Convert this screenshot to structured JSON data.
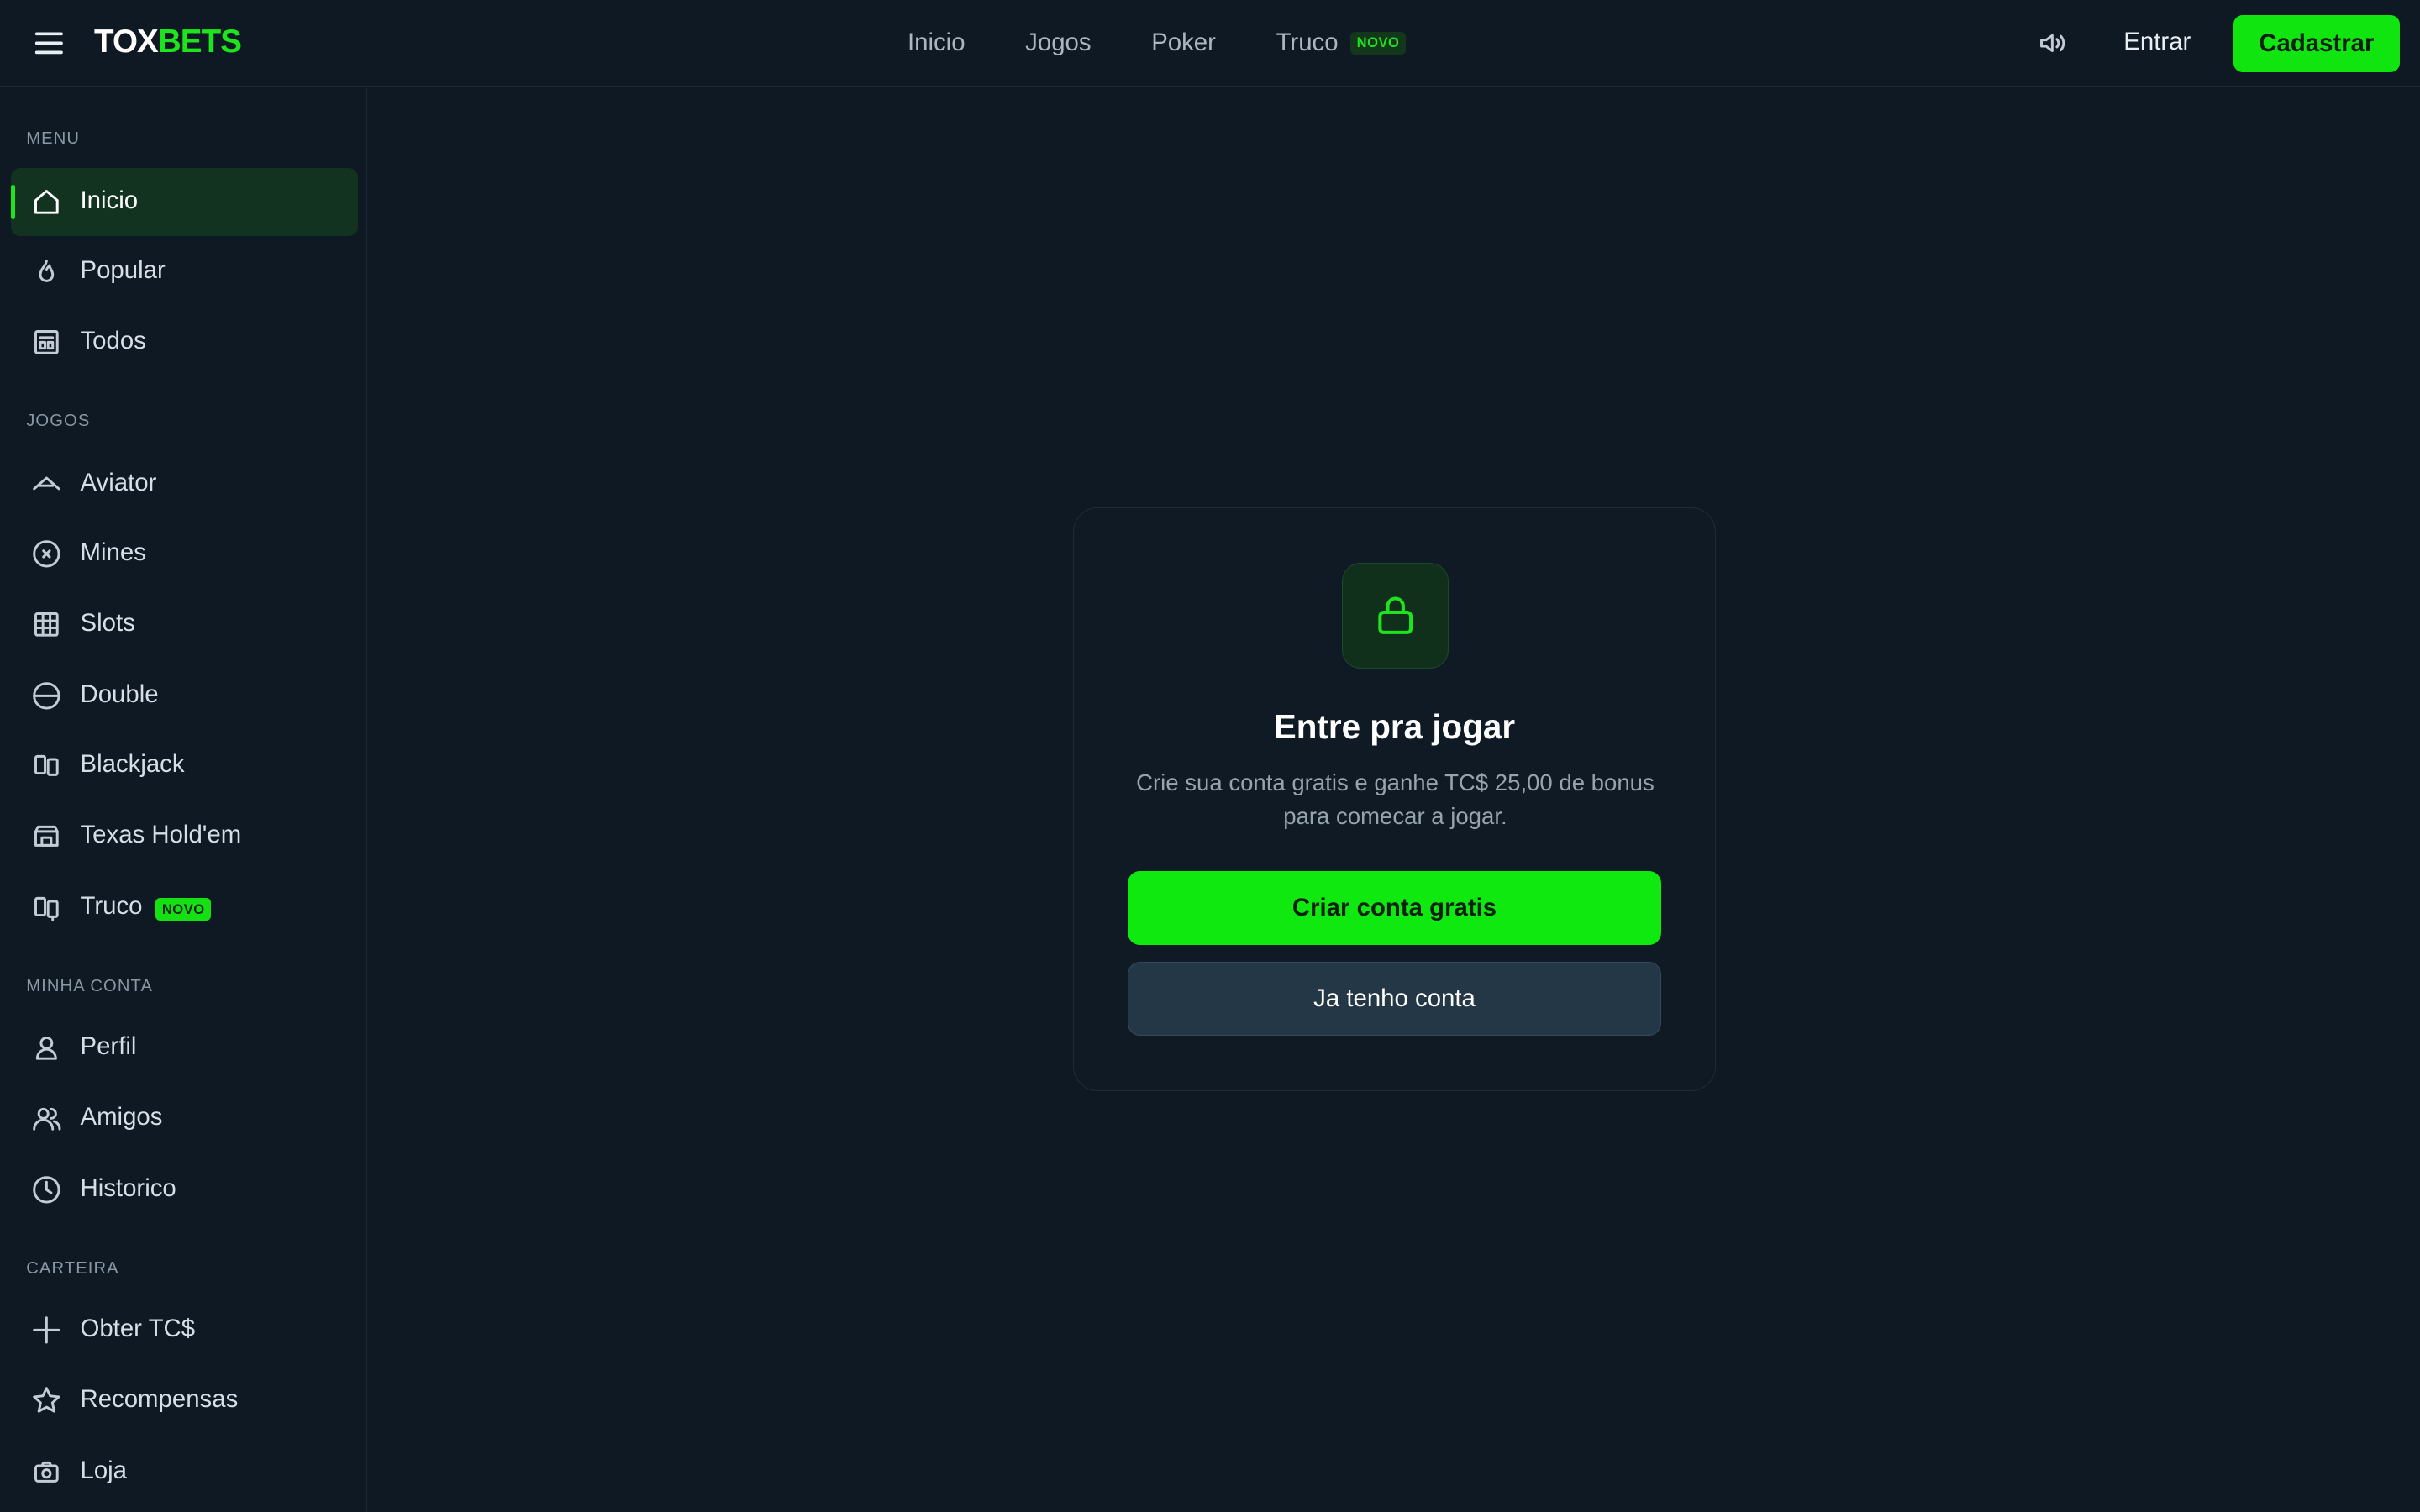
{
  "header": {
    "logo_part1": "TOX",
    "logo_part2": "BETS",
    "nav": [
      {
        "label": "Inicio"
      },
      {
        "label": "Jogos"
      },
      {
        "label": "Poker"
      },
      {
        "label": "Truco",
        "badge": "NOVO"
      }
    ],
    "login_label": "Entrar",
    "signup_label": "Cadastrar"
  },
  "sidebar": {
    "sections": [
      {
        "title": "MENU",
        "items": [
          {
            "label": "Inicio",
            "icon": "home-icon",
            "active": true
          },
          {
            "label": "Popular",
            "icon": "flame-icon"
          },
          {
            "label": "Todos",
            "icon": "grid-list-icon"
          }
        ]
      },
      {
        "title": "JOGOS",
        "items": [
          {
            "label": "Aviator",
            "icon": "plane-icon"
          },
          {
            "label": "Mines",
            "icon": "mine-icon"
          },
          {
            "label": "Slots",
            "icon": "slots-icon"
          },
          {
            "label": "Double",
            "icon": "double-icon"
          },
          {
            "label": "Blackjack",
            "icon": "cards-icon"
          },
          {
            "label": "Texas Hold'em",
            "icon": "poker-table-icon"
          },
          {
            "label": "Truco",
            "icon": "truco-cards-icon",
            "badge": "NOVO"
          }
        ]
      },
      {
        "title": "MINHA CONTA",
        "items": [
          {
            "label": "Perfil",
            "icon": "user-icon"
          },
          {
            "label": "Amigos",
            "icon": "users-icon"
          },
          {
            "label": "Historico",
            "icon": "clock-icon"
          }
        ]
      },
      {
        "title": "CARTEIRA",
        "items": [
          {
            "label": "Obter TC$",
            "icon": "plus-icon"
          },
          {
            "label": "Recompensas",
            "icon": "star-icon"
          },
          {
            "label": "Loja",
            "icon": "store-icon"
          }
        ]
      }
    ]
  },
  "card": {
    "title": "Entre pra jogar",
    "text": "Crie sua conta gratis e ganhe TC$ 25,00 de bonus para comecar a jogar.",
    "primary_label": "Criar conta gratis",
    "secondary_label": "Ja tenho conta"
  },
  "colors": {
    "background": "#0f1923",
    "accent": "#10e510",
    "sidebar_active": "#12331f"
  }
}
